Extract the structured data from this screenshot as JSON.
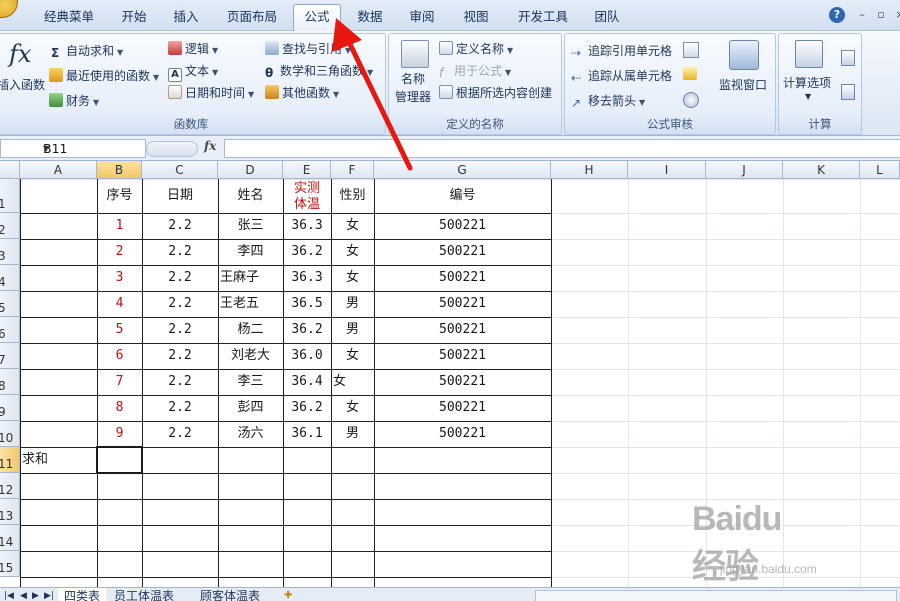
{
  "ribbon_tabs": [
    "经典菜单",
    "开始",
    "插入",
    "页面布局",
    "公式",
    "数据",
    "审阅",
    "视图",
    "开发工具",
    "团队"
  ],
  "active_tab": "公式",
  "groups": {
    "function_library": {
      "label": "函数库",
      "insert_function": "插入函数",
      "autosum": "自动求和",
      "recent": "最近使用的函数",
      "financial": "财务",
      "logical": "逻辑",
      "text": "文本",
      "datetime": "日期和时间",
      "lookup": "查找与引用",
      "math": "数学和三角函数",
      "other": "其他函数"
    },
    "defined_names": {
      "label": "定义的名称",
      "name_manager_line1": "名称",
      "name_manager_line2": "管理器",
      "define_name": "定义名称",
      "use_in_formula": "用于公式",
      "create_from_selection": "根据所选内容创建"
    },
    "formula_auditing": {
      "label": "公式审核",
      "trace_precedents": "追踪引用单元格",
      "trace_dependents": "追踪从属单元格",
      "remove_arrows": "移去箭头",
      "watch_window": "监视窗口"
    },
    "calculation": {
      "label": "计算",
      "calc_options": "计算选项"
    }
  },
  "name_box": "B11",
  "formula_value": "",
  "columns": [
    "A",
    "B",
    "C",
    "D",
    "E",
    "F",
    "G",
    "H",
    "I",
    "J",
    "K",
    "L"
  ],
  "selected_column": "B",
  "rows": [
    "1",
    "2",
    "3",
    "4",
    "5",
    "6",
    "7",
    "8",
    "9",
    "10",
    "11",
    "12",
    "13",
    "14",
    "15"
  ],
  "selected_row": "11",
  "table": {
    "headers": {
      "seq": "序号",
      "date": "日期",
      "name": "姓名",
      "temp_line1": "实测",
      "temp_line2": "体温",
      "gender": "性别",
      "code": "编号"
    },
    "records": [
      {
        "seq": "1",
        "date": "2.2",
        "name": "张三",
        "temp": "36.3",
        "gender": "女",
        "code": "500221"
      },
      {
        "seq": "2",
        "date": "2.2",
        "name": "李四",
        "temp": "36.2",
        "gender": "女",
        "code": "500221"
      },
      {
        "seq": "3",
        "date": "2.2",
        "name": "王麻子",
        "temp": "36.3",
        "gender": "女",
        "code": "500221"
      },
      {
        "seq": "4",
        "date": "2.2",
        "name": "王老五",
        "temp": "36.5",
        "gender": "男",
        "code": "500221"
      },
      {
        "seq": "5",
        "date": "2.2",
        "name": "杨二",
        "temp": "36.2",
        "gender": "男",
        "code": "500221"
      },
      {
        "seq": "6",
        "date": "2.2",
        "name": "刘老大",
        "temp": "36.0",
        "gender": "女",
        "code": "500221"
      },
      {
        "seq": "7",
        "date": "2.2",
        "name": "李三",
        "temp": "36.4",
        "gender": "女",
        "code": "500221"
      },
      {
        "seq": "8",
        "date": "2.2",
        "name": "彭四",
        "temp": "36.2",
        "gender": "女",
        "code": "500221"
      },
      {
        "seq": "9",
        "date": "2.2",
        "name": "汤六",
        "temp": "36.1",
        "gender": "男",
        "code": "500221"
      }
    ],
    "sum_label": "求和"
  },
  "sheet_tabs": [
    "四类表",
    "员工体温表",
    "顾客体温表"
  ],
  "watermark": {
    "logo": "Baidu经验",
    "url": "jingyan.baidu.com"
  },
  "colors": {
    "accent_red": "#c21010",
    "selection": "#f3c765",
    "ribbon": "#dbe6f4"
  }
}
